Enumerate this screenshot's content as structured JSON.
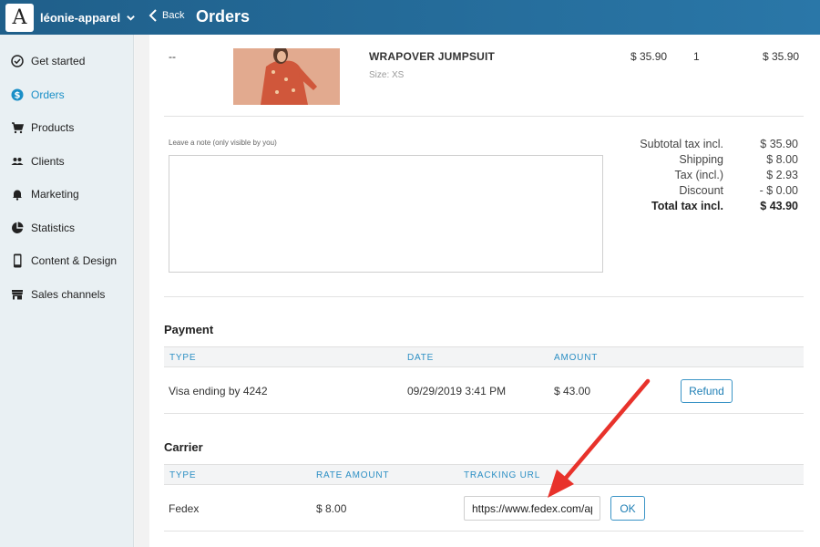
{
  "header": {
    "logo_letter": "A",
    "store_name": "léonie-apparel",
    "back_label": "Back",
    "page_title": "Orders"
  },
  "sidebar": {
    "items": [
      {
        "label": "Get started",
        "icon": "check-circle-icon",
        "active": false
      },
      {
        "label": "Orders",
        "icon": "dollar-circle-icon",
        "active": true
      },
      {
        "label": "Products",
        "icon": "cart-icon",
        "active": false
      },
      {
        "label": "Clients",
        "icon": "people-icon",
        "active": false
      },
      {
        "label": "Marketing",
        "icon": "bell-icon",
        "active": false
      },
      {
        "label": "Statistics",
        "icon": "pie-chart-icon",
        "active": false
      },
      {
        "label": "Content & Design",
        "icon": "mobile-phone-icon",
        "active": false
      },
      {
        "label": "Sales channels",
        "icon": "store-icon",
        "active": false
      }
    ]
  },
  "order_item": {
    "ref": "--",
    "name": "WRAPOVER JUMPSUIT",
    "size": "Size: XS",
    "unit_price": "$ 35.90",
    "quantity": "1",
    "line_total": "$ 35.90"
  },
  "note": {
    "label": "Leave a note (only visible by you)",
    "value": ""
  },
  "totals": [
    {
      "label": "Subtotal tax incl.",
      "value": "$ 35.90"
    },
    {
      "label": "Shipping",
      "value": "$ 8.00"
    },
    {
      "label": "Tax (incl.)",
      "value": "$ 2.93"
    },
    {
      "label": "Discount",
      "value": "- $ 0.00"
    },
    {
      "label": "Total tax incl.",
      "value": "$ 43.90"
    }
  ],
  "payment": {
    "title": "Payment",
    "columns": [
      "TYPE",
      "DATE",
      "AMOUNT"
    ],
    "row": {
      "type": "Visa ending by 4242",
      "date": "09/29/2019 3:41 PM",
      "amount": "$ 43.00"
    },
    "refund_label": "Refund"
  },
  "carrier": {
    "title": "Carrier",
    "columns": [
      "TYPE",
      "RATE AMOUNT",
      "TRACKING URL"
    ],
    "row": {
      "type": "Fedex",
      "rate": "$ 8.00"
    },
    "tracking_url": "https://www.fedex.com/apps",
    "ok_label": "OK"
  },
  "colors": {
    "header_blue": "#2a77a8",
    "accent": "#1a8fc7",
    "arrow_red": "#e8322b"
  }
}
